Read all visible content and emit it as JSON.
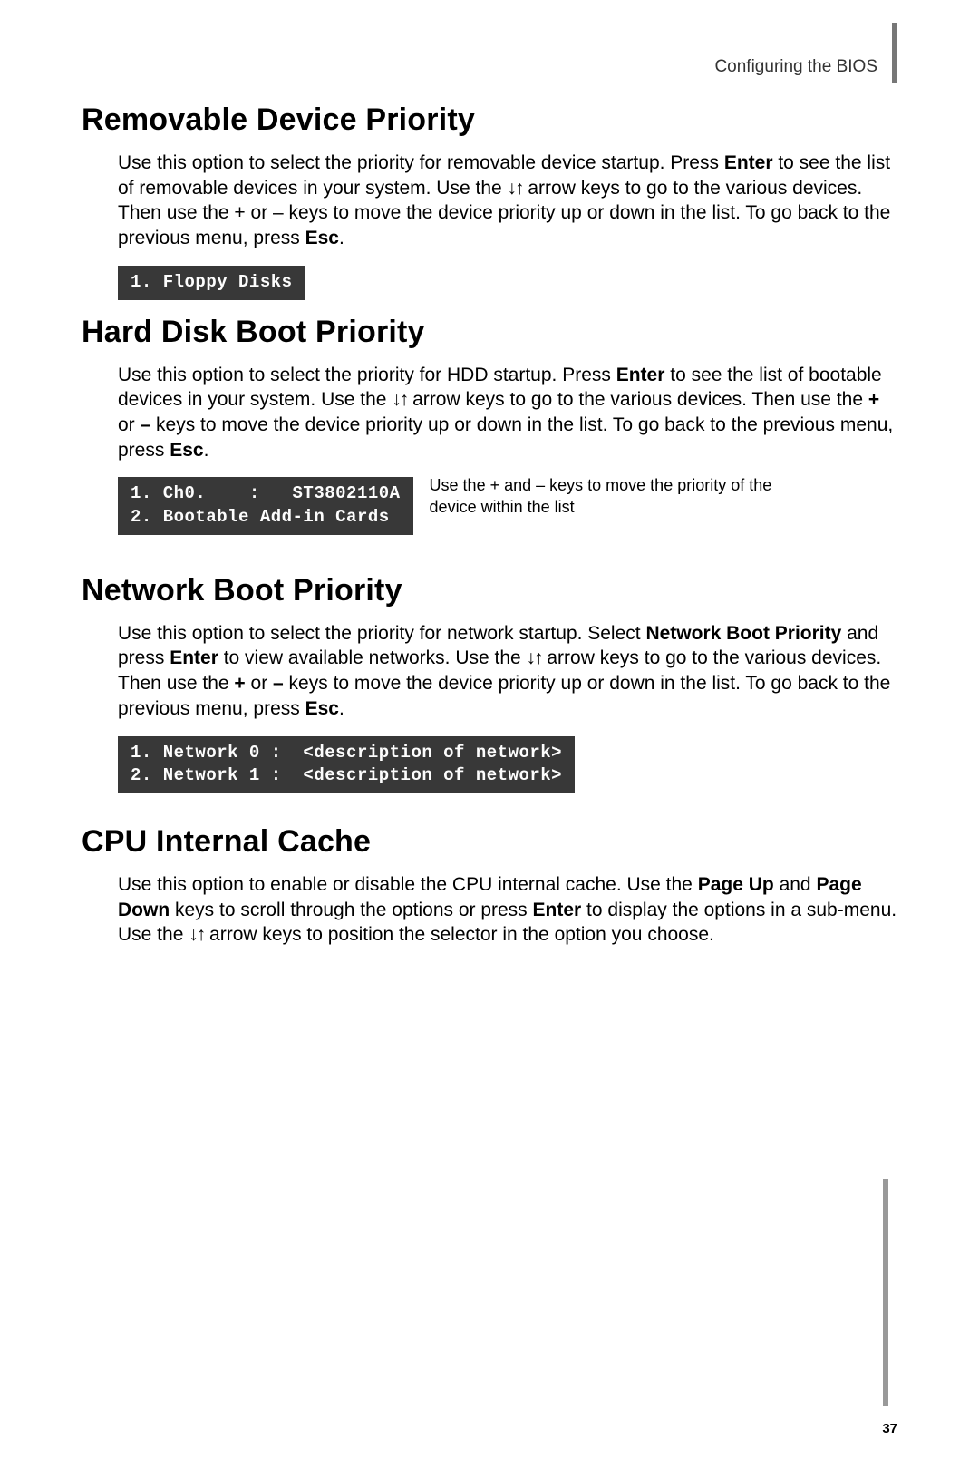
{
  "header": {
    "label": "Configuring the BIOS"
  },
  "sections": {
    "removable": {
      "title": "Removable Device Priority",
      "para_pre": "Use this option to select the priority for removable device startup. Press ",
      "bold1": "Enter",
      "para_mid1": " to see the list of removable devices in your system. Use the ",
      "arrows": "↓↑",
      "para_mid2": " arrow keys to go to the various devices. Then use the + or – keys to move the device priority up or down in the list. To go back to the previous menu, press ",
      "bold2": "Esc",
      "para_end": ".",
      "code": "1. Floppy Disks"
    },
    "harddisk": {
      "title": "Hard Disk Boot Priority",
      "para_pre": "Use this option to select the priority for HDD startup. Press ",
      "bold1": "Enter",
      "para_mid1": " to see the list of bootable devices in your system. Use the ",
      "arrows": "↓↑",
      "para_mid2": " arrow keys to go to the various devices. Then use the ",
      "bold_plus": "+",
      "para_or": " or ",
      "bold_minus": "–",
      "para_mid3": " keys to move the device priority up or down in the list. To go back to the previous menu, press ",
      "bold2": "Esc",
      "para_end": ".",
      "code": "1. Ch0.    :   ST3802110A\n2. Bootable Add-in Cards",
      "side_note": "Use the + and – keys to move the priority of the device within the list"
    },
    "network": {
      "title": "Network Boot Priority",
      "para_pre": "Use this option to select the priority for network startup. Select ",
      "bold1": "Network Boot Priority",
      "para_mid1": " and press ",
      "bold2": "Enter",
      "para_mid2": " to view available networks.  Use the ",
      "arrows": "↓↑",
      "para_mid3": " arrow keys to go to the various devices. Then use the ",
      "bold_plus": "+",
      "para_or": " or ",
      "bold_minus": "–",
      "para_mid4": " keys to move the device priority up or down in the list. To go back to the previous menu, press ",
      "bold3": "Esc",
      "para_end": ".",
      "code": "1. Network 0 :  <description of network>\n2. Network 1 :  <description of network>"
    },
    "cpu": {
      "title": "CPU Internal Cache",
      "para_pre": "Use this option to enable or disable the CPU internal cache. Use the ",
      "bold1": "Page Up",
      "para_and": " and ",
      "bold2": "Page Down",
      "para_mid1": " keys to scroll through the options or press ",
      "bold3": "Enter",
      "para_mid2": " to display the options in a sub-menu. Use the ",
      "arrows": "↓↑",
      "para_end": " arrow keys to position the selector in the option you choose."
    }
  },
  "page_number": "37"
}
